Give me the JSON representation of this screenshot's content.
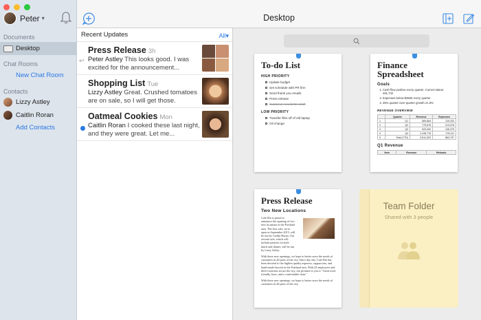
{
  "user": {
    "name": "Peter"
  },
  "sidebar": {
    "documents_header": "Documents",
    "documents": [
      {
        "label": "Desktop"
      }
    ],
    "chatrooms_header": "Chat Rooms",
    "new_chat_label": "New Chat Room",
    "contacts_header": "Contacts",
    "contacts": [
      {
        "label": "Lizzy Astley"
      },
      {
        "label": "Caitlin Roran"
      }
    ],
    "add_contacts_label": "Add Contacts"
  },
  "toolbar": {
    "title": "Desktop"
  },
  "updates": {
    "header": "Recent Updates",
    "filter": "All",
    "filter_arrow": "▾",
    "items": [
      {
        "name": "Press Release",
        "time": "3h",
        "author": "Peter Astley",
        "text": "This looks good. I was excited for the announcement..."
      },
      {
        "name": "Shopping List",
        "time": "Tue",
        "author": "Lizzy Astley",
        "text": "Great. Crushed tomatoes are on sale, so I will get those."
      },
      {
        "name": "Oatmeal Cookies",
        "time": "Mon",
        "author": "Caitlin Roran",
        "text": "I cooked these last night, and they were great. Let me..."
      }
    ]
  },
  "desktop": {
    "todo": {
      "title": "To-do List",
      "high_header": "HIGH PRIORITY",
      "high_items": [
        "Update budget",
        "Set schedule with PR firm",
        "Send thank you emails",
        "Press release",
        "Customer newsletter draft"
      ],
      "low_header": "LOW PRIORITY",
      "low_items": [
        "Transfer files off of old laptop",
        "Oil change"
      ]
    },
    "finance": {
      "title": "Finance Spreadsheet",
      "goals_header": "Goals",
      "goals": [
        "Cash flow positive every quarter. Current status: 461,732",
        "Expenses below $350K every quarter",
        "35% quarter-over-quarter growth 21.8%"
      ],
      "overview_header": "REVENUE OVERVIEW",
      "table_headers": [
        "Quarter",
        "Revenue",
        "Expenses"
      ],
      "table_rows": [
        [
          "Q1",
          "569,664",
          "125,333"
        ],
        [
          "Q2",
          "775,578",
          "213,978"
        ],
        [
          "Q3",
          "920,000",
          "246,375"
        ],
        [
          "Q4",
          "1,245,778",
          "278,111"
        ],
        [
          "Total (YTD)",
          "3,511,020",
          "863,797"
        ]
      ],
      "q1_header": "Q1 Revenue",
      "q1_cols": [
        "Item",
        "Revenue",
        "Refunds"
      ]
    },
    "press": {
      "title": "Press Release",
      "subtitle": "Two New Locations",
      "p1": "Cafe Ria is proud to announce the opening of two new locations in the Portland area. The first cafe, set to open in September 2015, will be run by Caitlin Roran. Our second cafe, which will include pastries for both lunch and dinner, will be run by Lizzy Astley.",
      "p2": "With these new openings, we hope to better serve the needs of customers in all parts of the city. Since day one, Cafe Ria has been devoted to the highest quality espresso, cappuccino, and hand-made biscotti in the Portland area. With 22 employees and three locations across the city, our promise to you is \"Great food, friendly faces, and a comfortable chair.\"",
      "p3": "With these new openings, we hope to better serve the needs of customers in all parts of the city."
    },
    "folder": {
      "title": "Team Folder",
      "subtitle": "Shared with 3 people"
    }
  },
  "colors": {
    "accent": "#2a78e4",
    "sidebar_bg": "#dde4ec",
    "folder": "#fbf0c4"
  }
}
